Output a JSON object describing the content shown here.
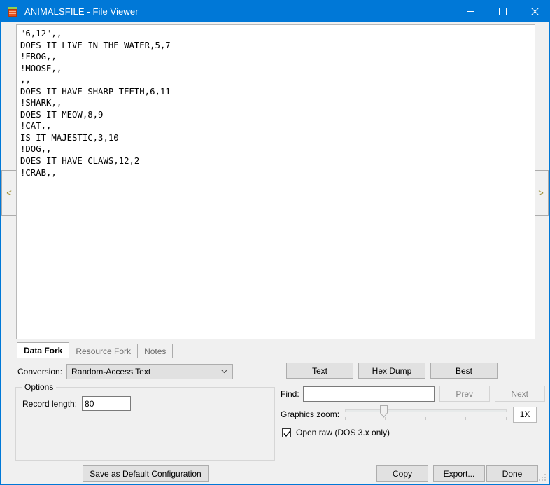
{
  "window": {
    "title": "ANIMALSFILE - File Viewer",
    "icon": "file-viewer-icon",
    "accent_color": "#0078d7",
    "controls": {
      "minimize": "minimize-icon",
      "maximize": "maximize-icon",
      "close": "close-icon"
    }
  },
  "navigation": {
    "prev_glyph": "<",
    "next_glyph": ">"
  },
  "viewer": {
    "content": "\"6,12\",,\nDOES IT LIVE IN THE WATER,5,7\n!FROG,,\n!MOOSE,,\n,,\nDOES IT HAVE SHARP TEETH,6,11\n!SHARK,,\nDOES IT MEOW,8,9\n!CAT,,\nIS IT MAJESTIC,3,10\n!DOG,,\nDOES IT HAVE CLAWS,12,2\n!CRAB,,"
  },
  "tabs": [
    {
      "label": "Data Fork",
      "active": true,
      "enabled": true
    },
    {
      "label": "Resource Fork",
      "active": false,
      "enabled": false
    },
    {
      "label": "Notes",
      "active": false,
      "enabled": false
    }
  ],
  "conversion": {
    "label": "Conversion:",
    "value": "Random-Access Text"
  },
  "options": {
    "legend": "Options",
    "record_length_label": "Record length:",
    "record_length_value": "80"
  },
  "view_buttons": {
    "text": "Text",
    "hex_dump": "Hex Dump",
    "best": "Best"
  },
  "find": {
    "label": "Find:",
    "value": "",
    "placeholder": "",
    "prev": "Prev",
    "next": "Next"
  },
  "graphics_zoom": {
    "label": "Graphics zoom:",
    "value": "1X",
    "slider_position_percent": 22,
    "tick_count": 5
  },
  "open_raw": {
    "label": "Open raw (DOS 3.x only)",
    "checked": true
  },
  "footer": {
    "save_default": "Save as Default Configuration",
    "copy": "Copy",
    "export": "Export...",
    "done": "Done"
  }
}
